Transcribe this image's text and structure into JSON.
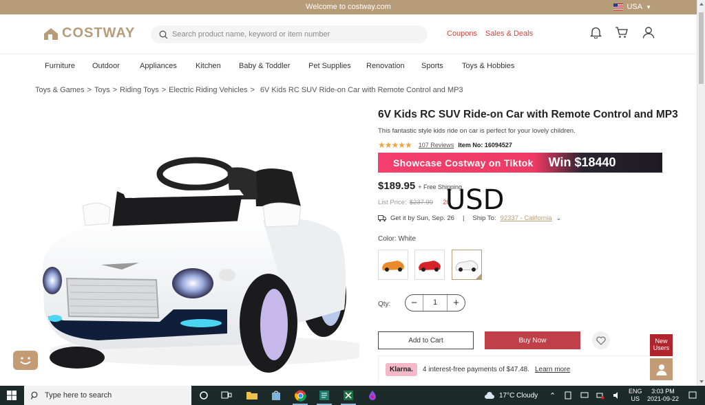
{
  "topbar": {
    "welcome": "Welcome to costway.com",
    "region": "USA"
  },
  "header": {
    "logo": "COSTWAY",
    "search_placeholder": "Search product name, keyword or item number",
    "coupons": "Coupons",
    "sales_deals": "Sales & Deals"
  },
  "nav": {
    "items": [
      "Furniture",
      "Outdoor",
      "Appliances",
      "Kitchen",
      "Baby & Toddler",
      "Pet Supplies",
      "Renovation",
      "Sports",
      "Toys & Hobbies"
    ]
  },
  "breadcrumb": [
    "Toys & Games",
    ">",
    "Toys",
    ">",
    "Riding Toys",
    ">",
    "Electric Riding Vehicles",
    ">",
    "6V Kids RC SUV Ride-on Car with Remote Control and MP3"
  ],
  "product": {
    "title": "6V Kids RC SUV Ride-on Car with Remote Control and MP3",
    "description": "This fantastic style kids ride on car is perfect for your lovely children.",
    "stars": "★★★★★",
    "rating": 5,
    "reviews": "107 Reviews",
    "item_no": "Item No: 16094527",
    "banner_left": "Showcase Costway on Tiktok",
    "banner_right": "Win $18440",
    "price": "$189.95",
    "shipping": "+ Free Shipping",
    "list_price_label": "List Price:",
    "list_price": "$237.99",
    "discount": "20",
    "overlay": "USD",
    "delivery": "Get it by Sun, Sep. 26",
    "separator": "|",
    "ship_to_label": "Ship To:",
    "ship_to": "92337 - California",
    "color_label": "Color: White",
    "swatches": [
      "orange",
      "red",
      "white"
    ],
    "qty_label": "Qty:",
    "qty": "1",
    "qty_minus": "−",
    "qty_plus": "+",
    "add_to_cart": "Add to Cart",
    "buy_now": "Buy Now",
    "klarna_badge": "Klarna.",
    "klarna_text": "4 interest-free payments of $47.48.",
    "klarna_link": "Learn more"
  },
  "floating": {
    "new_users_line1": "New",
    "new_users_line2": "Users"
  },
  "taskbar": {
    "search_placeholder": "Type here to search",
    "weather": "17°C  Cloudy",
    "lang1": "ENG",
    "lang2": "US",
    "time": "3:03 PM",
    "date": "2021-09-22"
  },
  "colors": {
    "brand": "#b79c79",
    "accent_red": "#c0404a",
    "link_red": "#d0443c",
    "star": "#f2a23a"
  }
}
